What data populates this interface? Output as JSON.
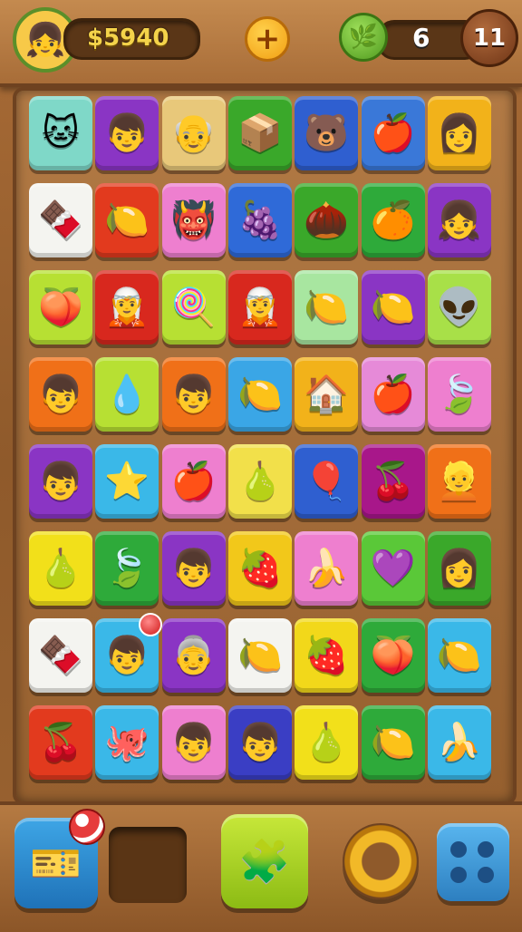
{
  "hud": {
    "avatar_icon": "👧",
    "money": "$5940",
    "plus_icon": "+",
    "leaf_icon": "🌿",
    "moves": "6",
    "level": "11"
  },
  "colors": {
    "wood": "#a86b36",
    "gold_text": "#f4d34a",
    "pill_bg": "#5a3617"
  },
  "board": {
    "rows": [
      [
        {
          "bg": "#7fd8c8",
          "icon": "🐱"
        },
        {
          "bg": "#8a35c4",
          "icon": "👦"
        },
        {
          "bg": "#e8c87a",
          "icon": "👴"
        },
        {
          "bg": "#3aa82a",
          "icon": "📦"
        },
        {
          "bg": "#2f5fd0",
          "icon": "🐻"
        },
        {
          "bg": "#3a78d8",
          "icon": "🍎"
        },
        {
          "bg": "#f2b21a",
          "icon": "👩"
        }
      ],
      [
        {
          "bg": "#f4f4f0",
          "icon": "🍫"
        },
        {
          "bg": "#e23a1e",
          "icon": "🍋"
        },
        {
          "bg": "#ee7fcf",
          "icon": "👹"
        },
        {
          "bg": "#2f6ad8",
          "icon": "🍇"
        },
        {
          "bg": "#3aa82a",
          "icon": "🌰"
        },
        {
          "bg": "#2eaa3a",
          "icon": "🍊"
        },
        {
          "bg": "#8a35c4",
          "icon": "👧"
        }
      ],
      [
        {
          "bg": "#b7e033",
          "icon": "🍑"
        },
        {
          "bg": "#d8281e",
          "icon": "🧝"
        },
        {
          "bg": "#b7e033",
          "icon": "🍭"
        },
        {
          "bg": "#d8281e",
          "icon": "🧝"
        },
        {
          "bg": "#a8e6a0",
          "icon": "🍋"
        },
        {
          "bg": "#8a35c4",
          "icon": "🍋"
        },
        {
          "bg": "#a8e048",
          "icon": "👽"
        }
      ],
      [
        {
          "bg": "#f07018",
          "icon": "👦"
        },
        {
          "bg": "#b7e033",
          "icon": "💧"
        },
        {
          "bg": "#f07018",
          "icon": "👦"
        },
        {
          "bg": "#3aa6e6",
          "icon": "🍋"
        },
        {
          "bg": "#f2b21a",
          "icon": "🏠"
        },
        {
          "bg": "#e68ad8",
          "icon": "🍎"
        },
        {
          "bg": "#ee7fcf",
          "icon": "🍃"
        }
      ],
      [
        {
          "bg": "#8a35c4",
          "icon": "👦"
        },
        {
          "bg": "#3ab8e8",
          "icon": "⭐"
        },
        {
          "bg": "#ee7fcf",
          "icon": "🍎"
        },
        {
          "bg": "#f2e04a",
          "icon": "🍐"
        },
        {
          "bg": "#2f5fd0",
          "icon": "🎈"
        },
        {
          "bg": "#a8178a",
          "icon": "🍒"
        },
        {
          "bg": "#f07018",
          "icon": "👱"
        }
      ],
      [
        {
          "bg": "#f2e01a",
          "icon": "🍐"
        },
        {
          "bg": "#2eaa3a",
          "icon": "🍃"
        },
        {
          "bg": "#8a35c4",
          "icon": "👦"
        },
        {
          "bg": "#f2c81a",
          "icon": "🍓"
        },
        {
          "bg": "#ee7fcf",
          "icon": "🍌"
        },
        {
          "bg": "#5ac838",
          "icon": "💜"
        },
        {
          "bg": "#3aa82a",
          "icon": "👩"
        }
      ],
      [
        {
          "bg": "#f4f4f0",
          "icon": "🍫"
        },
        {
          "bg": "#3ab8e8",
          "icon": "👦",
          "badge": true
        },
        {
          "bg": "#8a35c4",
          "icon": "👵"
        },
        {
          "bg": "#f4f4f0",
          "icon": "🍋"
        },
        {
          "bg": "#f2d81a",
          "icon": "🍓"
        },
        {
          "bg": "#2eaa3a",
          "icon": "🍑"
        },
        {
          "bg": "#3ab8e8",
          "icon": "🍋"
        }
      ],
      [
        {
          "bg": "#e23a1e",
          "icon": "🍒"
        },
        {
          "bg": "#3ab8e8",
          "icon": "🐙"
        },
        {
          "bg": "#ee7fcf",
          "icon": "👦"
        },
        {
          "bg": "#3a3ec4",
          "icon": "👦"
        },
        {
          "bg": "#f2e01a",
          "icon": "🍐"
        },
        {
          "bg": "#2eaa3a",
          "icon": "🍋"
        },
        {
          "bg": "#3ab8e8",
          "icon": "🍌"
        }
      ]
    ]
  },
  "bottom": {
    "left_icon": "🎫",
    "mid_icon": "🧩",
    "ring_icon": "ring",
    "right_icon": "dice"
  }
}
